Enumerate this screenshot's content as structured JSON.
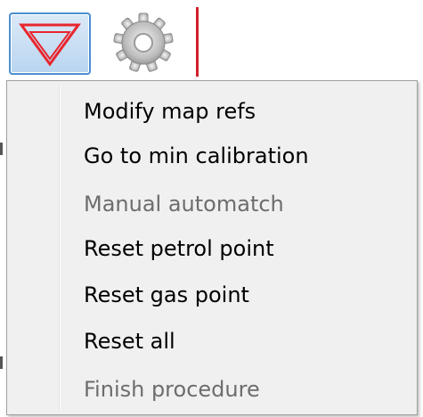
{
  "toolbar": {
    "filter_button": {
      "icon": "funnel-triangle-icon",
      "color": "#e8262e"
    },
    "settings_button": {
      "icon": "gear-icon"
    },
    "accent_color": "#4a8fd0"
  },
  "menu": {
    "items": [
      {
        "label": "Modify map refs",
        "enabled": true
      },
      {
        "label": "Go to min calibration",
        "enabled": true
      },
      {
        "label": "Manual automatch",
        "enabled": false
      },
      {
        "label": "Reset petrol point",
        "enabled": true
      },
      {
        "label": "Reset gas point",
        "enabled": true
      },
      {
        "label": "Reset all",
        "enabled": true
      },
      {
        "label": "Finish procedure",
        "enabled": false
      }
    ]
  }
}
